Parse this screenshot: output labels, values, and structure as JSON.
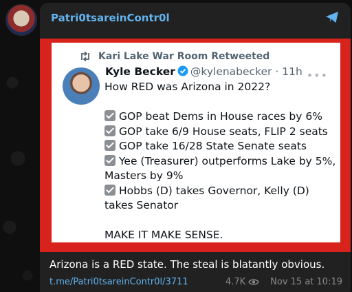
{
  "channel": {
    "name": "Patri0tsareinContr0l"
  },
  "tweet": {
    "retweet_label": "Kari Lake War Room Retweeted",
    "display_name": "Kyle Becker",
    "handle": "@kylenabecker",
    "separator": "·",
    "age": "11h",
    "lines": [
      "How RED was Arizona in 2022?",
      "GOP beat Dems in House races by 6%",
      "GOP take 6/9 House seats, FLIP 2 seats",
      "GOP take 16/28 State Senate seats",
      "Yee (Treasurer) outperforms Lake by 5%,",
      "Masters by 9%",
      "Hobbs (D) takes Governor, Kelly (D)",
      "takes Senator",
      "MAKE IT MAKE SENSE."
    ]
  },
  "post": {
    "caption": "Arizona is a RED state. The steal is blatantly obvious.",
    "link": "t.me/Patri0tsareinContr0l/3711",
    "views": "4.7K",
    "date": "Nov 15 at 10:19"
  },
  "colors": {
    "frame": "#d8231c",
    "link": "#62b2ee",
    "bubble": "#212121"
  },
  "icons": [
    "share-icon",
    "retweet-icon",
    "verified-icon",
    "more-icon",
    "eye-icon",
    "check-icon"
  ]
}
